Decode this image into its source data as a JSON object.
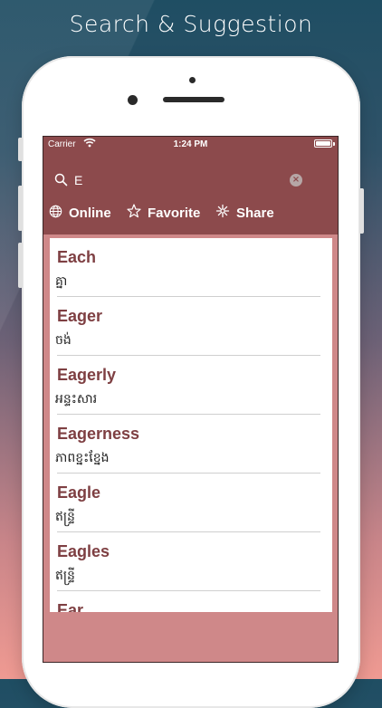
{
  "headline": "Search & Suggestion",
  "status_bar": {
    "carrier": "Carrier",
    "time": "1:24 PM"
  },
  "search": {
    "value": "E",
    "clear_symbol": "×"
  },
  "actions": [
    {
      "label": "Online",
      "icon": "globe-icon"
    },
    {
      "label": "Favorite",
      "icon": "star-icon"
    },
    {
      "label": "Share",
      "icon": "share-icon"
    }
  ],
  "results": [
    {
      "word": "Each",
      "meaning": "គ្នា"
    },
    {
      "word": "Eager",
      "meaning": "ចង់"
    },
    {
      "word": "Eagerly",
      "meaning": "អន្ទះសារ"
    },
    {
      "word": "Eagerness",
      "meaning": "ភាពខ្នះខ្នែង"
    },
    {
      "word": "Eagle",
      "meaning": "ឥន្ទ្រី"
    },
    {
      "word": "Eagles",
      "meaning": "ឥន្ទ្រី"
    },
    {
      "word": "Ear",
      "meaning": ""
    }
  ],
  "colors": {
    "header": "#8c4a4c",
    "word": "#7e3f42",
    "screen_bg": "#cf8889"
  }
}
